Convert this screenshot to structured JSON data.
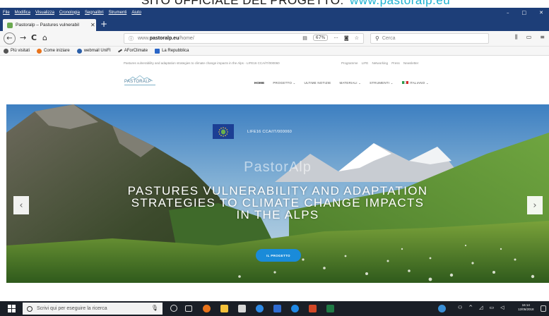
{
  "caption": {
    "text_main": "SITO UFFICIALE DEL PROGETTO:",
    "text_url": "www.pastoralp.eu"
  },
  "menubar": {
    "items": [
      "File",
      "Modifica",
      "Visualizza",
      "Cronologia",
      "Segnalibri",
      "Strumenti",
      "Aiuto"
    ],
    "minimize": "–",
    "maximize": "□",
    "close": "✕"
  },
  "tab": {
    "title": "Pastoralp – Pastures vulnerabil",
    "close": "✕",
    "new": "+"
  },
  "navbar": {
    "back": "←",
    "forward": "→",
    "reload": "C",
    "home": "⌂",
    "url_prefix": "www.",
    "url_domain": "pastoralp.eu",
    "url_path": "/home/",
    "zoom": "67%",
    "more": "···",
    "search_placeholder": "Cerca"
  },
  "bookmarks": [
    {
      "label": "Più visitati",
      "color": "#555555"
    },
    {
      "label": "Come iniziare",
      "color": "#e8731b"
    },
    {
      "label": "webmail UniFI",
      "color": "#2b5fa8"
    },
    {
      "label": "AForClimate",
      "color": "#444444"
    },
    {
      "label": "La Repubblica",
      "color": "#2a66c7"
    }
  ],
  "site": {
    "topline_left": "Pastures vulnerability and adaptation strategies to climate change impacts in the Alps - LIFE16 CCA/IT/000060",
    "topline_right": "Programme LIFE   Networking   Press   Newsletter",
    "logo": "PASTORALP",
    "nav": [
      {
        "label": "HOME"
      },
      {
        "label": "PROGETTO ⌄"
      },
      {
        "label": "ULTIME NOTIZIE"
      },
      {
        "label": "MATERIALI ⌄"
      },
      {
        "label": "STRUMENTI ⌄"
      },
      {
        "label": "ITALIANO ⌄"
      }
    ]
  },
  "hero": {
    "life_code": "LIFE16 CCA/IT/000060",
    "brand": "PastorAlp",
    "title_lines": [
      "PASTURES VULNERABILITY AND ADAPTATION",
      "STRATEGIES TO CLIMATE CHANGE IMPACTS",
      "IN THE ALPS"
    ],
    "button": "IL PROGETTO",
    "prev": "‹",
    "next": "›"
  },
  "taskbar": {
    "search_placeholder": "Scrivi qui per eseguire la ricerca",
    "time": "16:14",
    "date": "12/05/2018"
  }
}
